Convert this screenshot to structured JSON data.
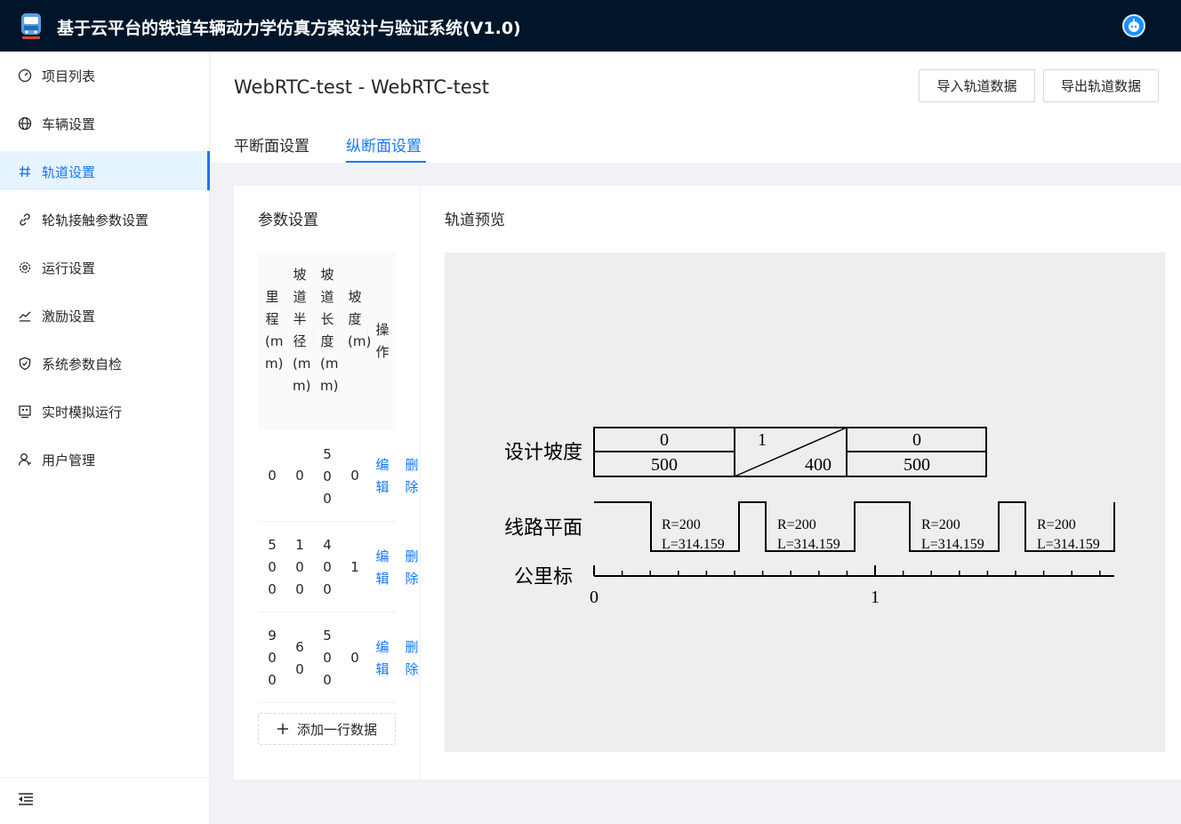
{
  "app": {
    "title": "基于云平台的铁道车辆动力学仿真方案设计与验证系统(V1.0)"
  },
  "sidebar": {
    "items": [
      {
        "label": "项目列表",
        "icon": "dashboard-icon"
      },
      {
        "label": "车辆设置",
        "icon": "globe-icon"
      },
      {
        "label": "轨道设置",
        "icon": "hash-icon",
        "active": true
      },
      {
        "label": "轮轨接触参数设置",
        "icon": "link-icon"
      },
      {
        "label": "运行设置",
        "icon": "gear-icon"
      },
      {
        "label": "激励设置",
        "icon": "stock-icon"
      },
      {
        "label": "系统参数自检",
        "icon": "shield-check-icon"
      },
      {
        "label": "实时模拟运行",
        "icon": "monitor-icon"
      },
      {
        "label": "用户管理",
        "icon": "user-icon"
      }
    ]
  },
  "page": {
    "title": "WebRTC-test - WebRTC-test",
    "import_button": "导入轨道数据",
    "export_button": "导出轨道数据",
    "tabs": [
      {
        "label": "平断面设置",
        "active": false
      },
      {
        "label": "纵断面设置",
        "active": true
      }
    ]
  },
  "params": {
    "title": "参数设置",
    "columns": [
      "里程(mm)",
      "坡道半径(mm)",
      "坡道长度(mm)",
      "坡度(m)",
      "操作"
    ],
    "rows": [
      {
        "mileage": "0",
        "radius": "0",
        "length": "500",
        "grade": "0"
      },
      {
        "mileage": "500",
        "radius": "100",
        "length": "400",
        "grade": "1"
      },
      {
        "mileage": "900",
        "radius": "60",
        "length": "500",
        "grade": "0"
      }
    ],
    "edit_label": "编辑",
    "delete_label": "删除",
    "add_row_label": "添加一行数据"
  },
  "preview": {
    "title": "轨道预览",
    "grade_label": "设计坡度",
    "plan_label": "线路平面",
    "km_label": "公里标",
    "grade_segments": [
      {
        "grade": "0",
        "length": "500"
      },
      {
        "grade": "1",
        "length": "400"
      },
      {
        "grade": "0",
        "length": "500"
      }
    ],
    "curves": [
      {
        "r": "R=200",
        "l": "L=314.159"
      },
      {
        "r": "R=200",
        "l": "L=314.159"
      },
      {
        "r": "R=200",
        "l": "L=314.159"
      },
      {
        "r": "R=200",
        "l": "L=314.159"
      }
    ],
    "km_ticks": [
      "0",
      "1"
    ]
  },
  "colors": {
    "header_bg": "#001529",
    "accent": "#1677ff",
    "preview_bg": "#eeeeee"
  }
}
